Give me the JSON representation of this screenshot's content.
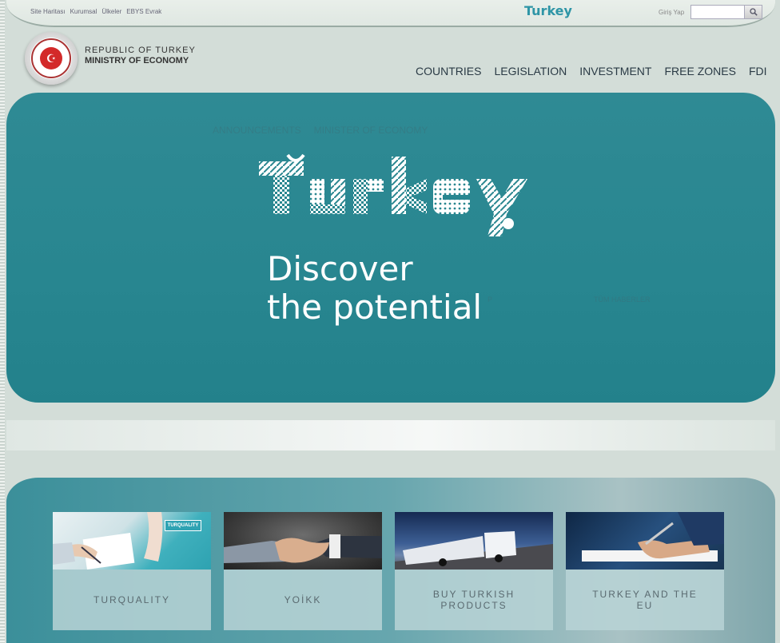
{
  "topbar": {
    "links": [
      "Site Haritası",
      "Kurumsal",
      "Ülkeler",
      "EBYS Evrak"
    ],
    "brand": "Turkey",
    "login_label": "Giriş Yap",
    "search_placeholder": ""
  },
  "header": {
    "line1": "REPUBLIC OF TURKEY",
    "line2": "MINISTRY OF ECONOMY",
    "nav": [
      "COUNTRIES",
      "LEGISLATION",
      "INVESTMENT",
      "FREE ZONES",
      "FDI"
    ]
  },
  "hero": {
    "faint_tabs": [
      "ANNOUNCEMENTS",
      "MINISTER OF ECONOMY"
    ],
    "faint_right": "TÜM HABERLER",
    "faint_mid": "P",
    "tagline_line1": "Discover",
    "tagline_line2": "the potential",
    "logo_word": "Turkey"
  },
  "cards": [
    {
      "label": "TURQUALITY",
      "badge": "TURQUALITY"
    },
    {
      "label": "YOİKK"
    },
    {
      "label": "BUY TURKISH PRODUCTS"
    },
    {
      "label": "TURKEY AND THE EU"
    }
  ],
  "colors": {
    "accent": "#2e95a6",
    "hero_bg": "#288690",
    "brand_red": "#d32a2a"
  }
}
